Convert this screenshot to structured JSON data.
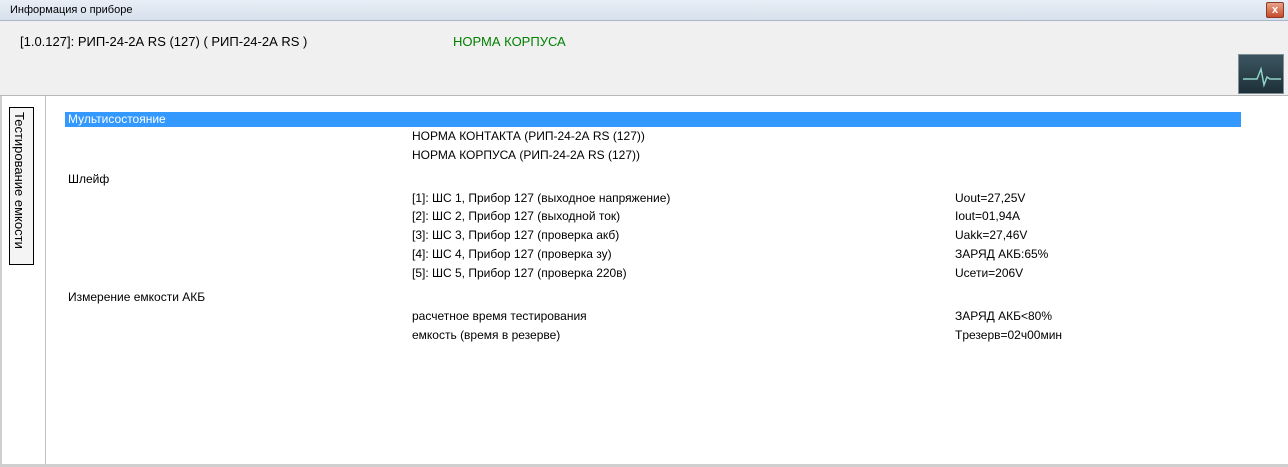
{
  "window": {
    "title": "Информация о приборе",
    "close_glyph": "x"
  },
  "header": {
    "device_name": "[1.0.127]: РИП-24-2А RS (127) ( РИП-24-2А RS )",
    "device_status": "НОРМА КОРПУСА",
    "status_color": "#008000",
    "icon": "heartbeat-monitor-icon"
  },
  "side_tab": {
    "label": "Тестирование емкости"
  },
  "tree": {
    "selected_label": "Мультисостояние",
    "selection_color": "#3399ff",
    "multistate": [
      "НОРМА КОНТАКТА (РИП-24-2А RS (127))",
      "НОРМА КОРПУСА (РИП-24-2А RS (127))"
    ],
    "loop": {
      "label": "Шлейф",
      "rows": [
        {
          "name": "[1]: ШС 1, Прибор 127 (выходное напряжение)",
          "value": "Uout=27,25V"
        },
        {
          "name": "[2]: ШС 2, Прибор 127 (выходной ток)",
          "value": "Iout=01,94A"
        },
        {
          "name": "[3]: ШС 3, Прибор 127 (проверка акб)",
          "value": "Uakk=27,46V"
        },
        {
          "name": "[4]: ШС 4, Прибор 127 (проверка зу)",
          "value": "ЗАРЯД АКБ:65%"
        },
        {
          "name": "[5]: ШС 5, Прибор 127 (проверка 220в)",
          "value": "Uсети=206V"
        }
      ]
    },
    "battery": {
      "label": "Измерение емкости АКБ",
      "rows": [
        {
          "name": "расчетное время тестирования",
          "value": "ЗАРЯД АКБ<80%"
        },
        {
          "name": "емкость (время в резерве)",
          "value": "Tрезерв=02ч00мин"
        }
      ]
    }
  }
}
